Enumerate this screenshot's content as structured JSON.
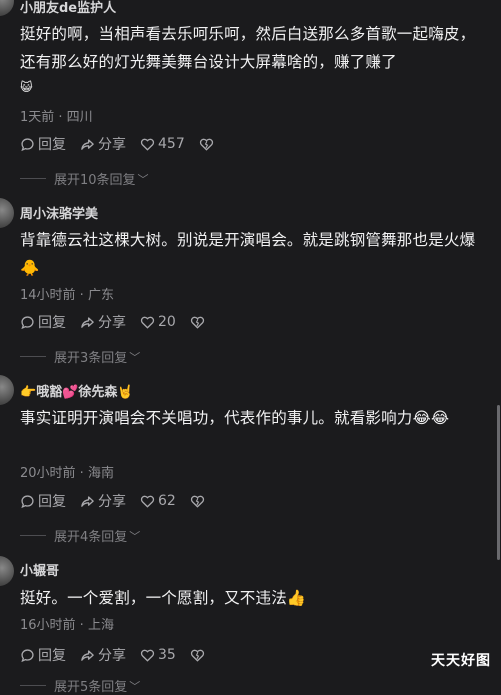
{
  "comments": [
    {
      "username": "小朋友de监护人",
      "text": "挺好的啊，当相声看去乐呵乐呵，然后白送那么多首歌一起嗨皮，还有那么好的灯光舞美舞台设计大屏幕啥的，赚了赚了",
      "sticker": "😺",
      "meta": "1天前 · 四川",
      "reply_label": "回复",
      "share_label": "分享",
      "likes": "457",
      "expand_label": "展开10条回复"
    },
    {
      "username": "周小沫骆学美",
      "text": "背靠德云社这棵大树。别说是开演唱会。就是跳钢管舞那也是火爆🐥",
      "meta": "14小时前 · 广东",
      "reply_label": "回复",
      "share_label": "分享",
      "likes": "20",
      "expand_label": "展开3条回复"
    },
    {
      "username_prefix": "👉",
      "username": "哦豁",
      "username_mid": "💕",
      "username2": "徐先森",
      "username_suffix": "🤘",
      "text": "事实证明开演唱会不关唱功，代表作的事儿。就看影响力😂😂",
      "meta": "20小时前 · 海南",
      "reply_label": "回复",
      "share_label": "分享",
      "likes": "62",
      "expand_label": "展开4条回复"
    },
    {
      "username": "小辗哥",
      "text": "挺好。一个爱割，一个愿割，又不违法👍",
      "meta": "16小时前 · 上海",
      "reply_label": "回复",
      "share_label": "分享",
      "likes": "35",
      "expand_label": "展开5条回复"
    }
  ],
  "icons": {
    "reply": "comment-bubble-icon",
    "share": "share-arrow-icon",
    "like": "heart-icon",
    "dislike": "broken-heart-icon",
    "expand": "chevron-down-icon"
  },
  "watermark": "天天好图",
  "colors": {
    "background": "#1b1b1d",
    "text": "#f1f1f2",
    "meta": "#8b8b8f"
  }
}
